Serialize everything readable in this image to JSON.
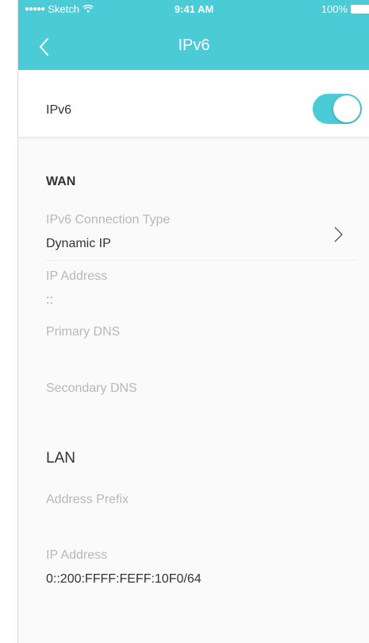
{
  "status_bar": {
    "carrier": "Sketch",
    "time": "9:41 AM",
    "battery": "100%"
  },
  "nav": {
    "title": "IPv6"
  },
  "ipv6_section": {
    "label": "IPv6",
    "enabled": true
  },
  "wan": {
    "title": "WAN",
    "connection_type_label": "IPv6 Connection Type",
    "connection_type_value": "Dynamic IP",
    "ip_address_label": "IP Address",
    "ip_address_value": "::",
    "primary_dns_label": "Primary DNS",
    "primary_dns_value": "",
    "secondary_dns_label": "Secondary DNS",
    "secondary_dns_value": ""
  },
  "lan": {
    "title": "LAN",
    "address_prefix_label": "Address Prefix",
    "address_prefix_value": "",
    "ip_address_label": "IP Address",
    "ip_address_value": "0::200:FFFF:FEFF:10F0/64"
  },
  "colors": {
    "accent": "#4acbd6",
    "background": "#fafafa",
    "label": "#b8b8b8",
    "text": "#333333"
  }
}
